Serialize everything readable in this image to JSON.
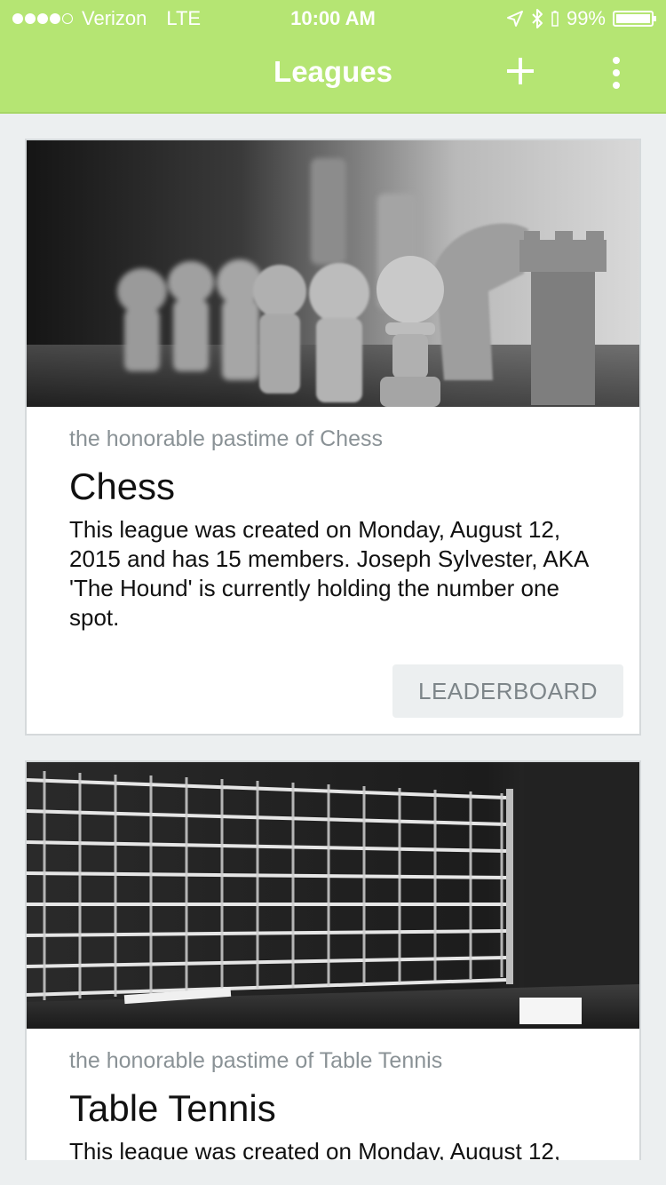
{
  "status_bar": {
    "carrier": "Verizon",
    "network": "LTE",
    "time": "10:00 AM",
    "battery_percent": "99%",
    "battery_level": 0.99,
    "signal_bars_filled": 4,
    "signal_bars_total": 5
  },
  "navbar": {
    "title": "Leagues",
    "add_icon": "plus-icon",
    "more_icon": "more-vertical-icon"
  },
  "colors": {
    "navbar_bg": "#B5E573",
    "page_bg": "#ECEFF0",
    "card_bg": "#FFFFFF",
    "subtitle_text": "#8A9296",
    "button_bg": "#ECEFF0",
    "button_text": "#7D8589"
  },
  "leagues": [
    {
      "image": "chess-pieces-photo",
      "subtitle": "the honorable pastime of Chess",
      "title": "Chess",
      "description": "This league was created on Monday, August 12, 2015 and has 15 members. Joseph Sylvester, AKA 'The Hound' is currently holding the number one spot.",
      "button_label": "LEADERBOARD"
    },
    {
      "image": "table-tennis-net-photo",
      "subtitle": "the honorable pastime of Table Tennis",
      "title": "Table Tennis",
      "description": "This league was created on Monday, August 12,"
    }
  ]
}
